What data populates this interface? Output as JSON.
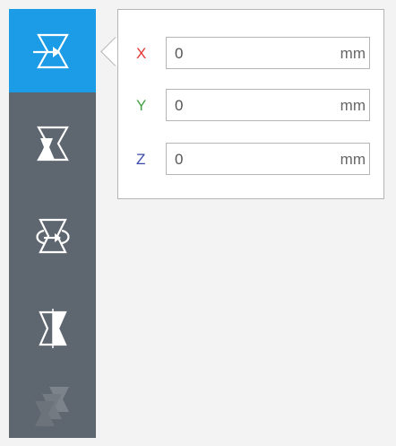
{
  "colors": {
    "toolbar_bg": "#5e6670",
    "active_tool_bg": "#1c9be6",
    "x_axis": "#e53935",
    "y_axis": "#43a047",
    "z_axis": "#3949ab"
  },
  "toolbar": {
    "tools": [
      {
        "icon": "move-icon",
        "state": "active"
      },
      {
        "icon": "scale-icon",
        "state": "normal"
      },
      {
        "icon": "rotate-icon",
        "state": "normal"
      },
      {
        "icon": "mirror-icon",
        "state": "normal"
      },
      {
        "icon": "per-model-settings-icon",
        "state": "disabled"
      }
    ]
  },
  "move_panel": {
    "fields": [
      {
        "axis": "X",
        "value": "0",
        "unit": "mm"
      },
      {
        "axis": "Y",
        "value": "0",
        "unit": "mm"
      },
      {
        "axis": "Z",
        "value": "0",
        "unit": "mm"
      }
    ]
  }
}
